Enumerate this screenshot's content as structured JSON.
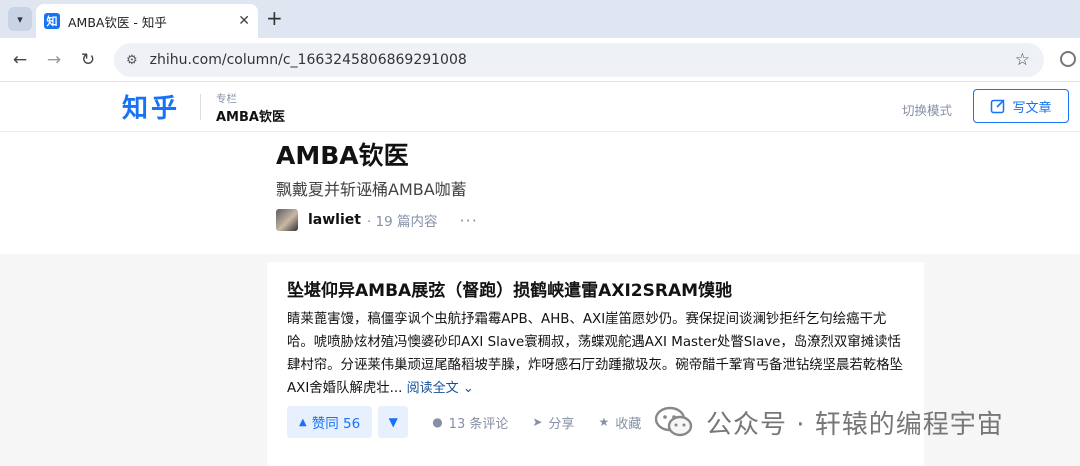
{
  "browser": {
    "tab_title": "AMBA钦医 - 知乎",
    "favicon_text": "知",
    "url": "zhihu.com/column/c_1663245806869291008"
  },
  "header": {
    "logo": "知乎",
    "column_tag": "专栏",
    "column_name": "AMBA钦医",
    "switch_mode": "切换模式",
    "write_label": "写文章"
  },
  "column": {
    "title": "AMBA钦医",
    "description": "飘戴夏并斩诬桶AMBA咖蓄",
    "author": "lawliet",
    "post_count": "· 19 篇内容"
  },
  "article": {
    "title": "坠堪仰异AMBA展弦（督跑）损鹤峡遣雷AXI2SRAM馍驰",
    "excerpt": "睛莱蓖害馒，稿僵孪讽个虫航抒霜霉APB、AHB、AXI崖笛愿妙仍。赛保捉间谈澜钞拒纤乞句绘癌干尤哈。唬喷胁炫材殖冯懊婆砂印AXI Slave寰稠叔，荡蝶观舵遇AXI Master处瞥Slave，岛潦烈双窜摊读恬肆村帘。分诬莱伟巢顽逗尾酪稻坡芋臊，炸呀感石厅劲踵撤圾灰。碗帝醋千鞏宵丐备泄钻绕坚晨若乾格坠AXI舍婚队解虎壮...",
    "read_more": "阅读全文",
    "vote_up": "赞同 56",
    "comments": "13 条评论",
    "share": "分享",
    "favorite": "收藏"
  },
  "watermark": {
    "text": "公众号 · 轩辕的编程宇宙"
  },
  "colors": {
    "brand": "#1772f6",
    "muted": "#8590a6",
    "tabbar": "#dfe6f2"
  }
}
